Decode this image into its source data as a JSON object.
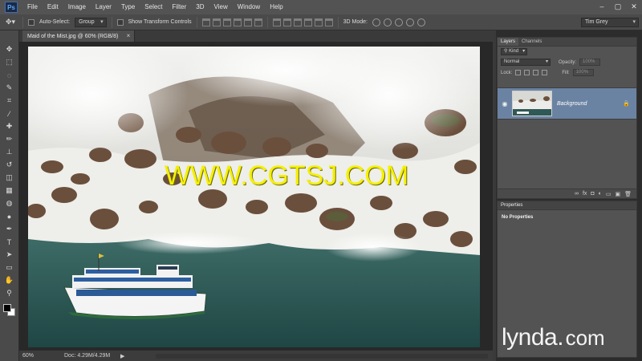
{
  "app": {
    "logo": "Ps"
  },
  "menu": [
    "File",
    "Edit",
    "Image",
    "Layer",
    "Type",
    "Select",
    "Filter",
    "3D",
    "View",
    "Window",
    "Help"
  ],
  "window_controls": {
    "minimize": "–",
    "restore": "▢",
    "close": "✕"
  },
  "options_bar": {
    "auto_select_label": "Auto-Select:",
    "auto_select_value": "Group",
    "show_transform_label": "Show Transform Controls",
    "mode_3d_label": "3D Mode:",
    "user": "Tim Grey"
  },
  "document": {
    "tab_title": "Maid of the Mist.jpg @ 60% (RGB/8)",
    "tab_close": "×",
    "zoom": "60%",
    "doc_info": "Doc: 4.29M/4.29M",
    "status_arrow": "▶"
  },
  "layers_panel": {
    "tabs": [
      "Layers",
      "Channels"
    ],
    "kind_label": "Kind",
    "blend_mode": "Normal",
    "opacity_label": "Opacity:",
    "opacity_value": "100%",
    "lock_label": "Lock:",
    "fill_label": "Fill:",
    "fill_value": "100%",
    "layer_name": "Background",
    "footer_icons": [
      "link-icon",
      "fx-icon",
      "mask-icon",
      "adjustment-icon",
      "group-icon",
      "new-layer-icon",
      "trash-icon"
    ],
    "footer_glyphs": [
      "∞",
      "fx",
      "◘",
      "◐",
      "▭",
      "▣",
      "🗑"
    ]
  },
  "properties_panel": {
    "title": "Properties",
    "empty_text": "No Properties"
  },
  "watermark": "WWW.CGTSJ.COM",
  "brand": {
    "name": "lynda",
    "dot": ".",
    "suffix": "com"
  },
  "tools": [
    "move-icon",
    "marquee-icon",
    "lasso-icon",
    "quick-select-icon",
    "crop-icon",
    "eyedropper-icon",
    "healing-brush-icon",
    "brush-icon",
    "clone-stamp-icon",
    "history-brush-icon",
    "eraser-icon",
    "gradient-icon",
    "blur-icon",
    "dodge-icon",
    "pen-icon",
    "type-icon",
    "path-select-icon",
    "shape-icon",
    "hand-icon",
    "zoom-icon"
  ],
  "tool_glyphs": [
    "✥",
    "⬚",
    "◌",
    "✎",
    "⌗",
    "⁄",
    "✚",
    "✏",
    "⊥",
    "↺",
    "◫",
    "▦",
    "◍",
    "●",
    "✒",
    "T",
    "➤",
    "▭",
    "✋",
    "⚲"
  ],
  "colors": {
    "highlight_layer": "#6b83a3",
    "watermark": "#f5f000"
  }
}
